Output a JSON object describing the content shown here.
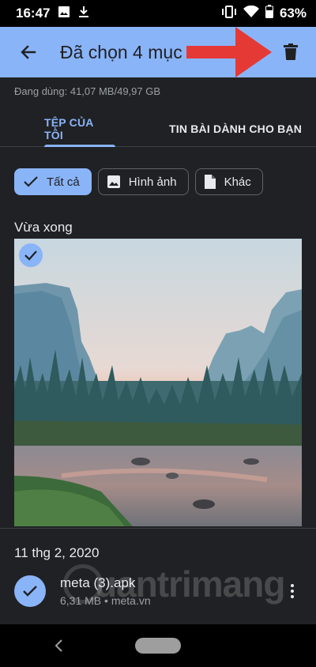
{
  "status_bar": {
    "time": "16:47",
    "battery": "63%",
    "icons": [
      "image-notification-icon",
      "download-icon",
      "vibrate-icon",
      "wifi-icon",
      "battery-icon"
    ]
  },
  "app_bar": {
    "title": "Đã chọn 4 mục",
    "color": "#8ab4f8"
  },
  "storage": {
    "text": "Đang dùng: 41,07 MB/49,97 GB"
  },
  "tabs": [
    {
      "label": "TỆP CỦA TÔI",
      "active": true
    },
    {
      "label": "TIN BÀI DÀNH CHO BẠN",
      "active": false
    }
  ],
  "chips": [
    {
      "label": "Tất cả",
      "icon": "check-icon",
      "selected": true
    },
    {
      "label": "Hình ảnh",
      "icon": "image-icon",
      "selected": false
    },
    {
      "label": "Khác",
      "icon": "file-icon",
      "selected": false
    }
  ],
  "sections": {
    "recent": "Vừa xong",
    "date": "11 thg 2, 2020"
  },
  "file": {
    "name": "meta (3).apk",
    "meta": "6,31 MB • meta.vn"
  },
  "watermark": "uantrimang",
  "colors": {
    "accent": "#8ab4f8",
    "background": "#202124",
    "annotation_arrow": "#e53935"
  }
}
